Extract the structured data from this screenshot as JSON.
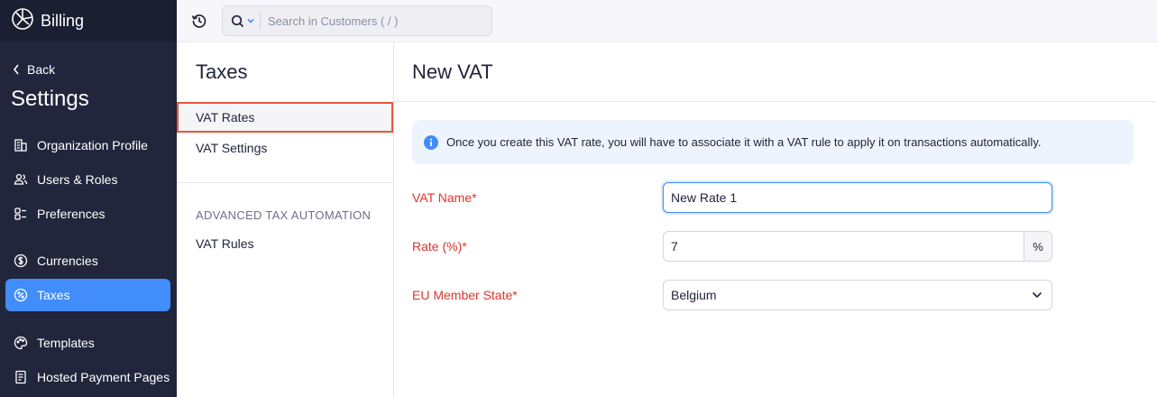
{
  "brand": {
    "name": "Billing"
  },
  "sidebar": {
    "back_label": "Back",
    "title": "Settings",
    "items": [
      {
        "label": "Organization Profile",
        "icon": "organization-icon",
        "active": false
      },
      {
        "label": "Users & Roles",
        "icon": "users-icon",
        "active": false
      },
      {
        "label": "Preferences",
        "icon": "preferences-icon",
        "active": false
      },
      {
        "label": "Currencies",
        "icon": "currency-icon",
        "active": false
      },
      {
        "label": "Taxes",
        "icon": "tax-icon",
        "active": true
      },
      {
        "label": "Templates",
        "icon": "palette-icon",
        "active": false
      },
      {
        "label": "Hosted Payment Pages",
        "icon": "document-icon",
        "active": false
      }
    ]
  },
  "topbar": {
    "search_placeholder": "Search in Customers ( / )"
  },
  "subnav": {
    "title": "Taxes",
    "items": [
      {
        "label": "VAT Rates",
        "selected": true
      },
      {
        "label": "VAT Settings",
        "selected": false
      }
    ],
    "section_label": "ADVANCED TAX AUTOMATION",
    "section_items": [
      {
        "label": "VAT Rules"
      }
    ]
  },
  "main": {
    "title": "New VAT",
    "info_text": "Once you create this VAT rate, you will have to associate it with a VAT rule to apply it on transactions automatically.",
    "form": {
      "vat_name_label": "VAT Name*",
      "vat_name_value": "New Rate 1",
      "rate_label": "Rate (%)*",
      "rate_value": "7",
      "rate_suffix": "%",
      "eu_state_label": "EU Member State*",
      "eu_state_value": "Belgium"
    }
  },
  "colors": {
    "sidebar_bg": "#21263c",
    "accent": "#408dfb",
    "required_label": "#d6372c",
    "selected_outline": "#e8543f"
  }
}
